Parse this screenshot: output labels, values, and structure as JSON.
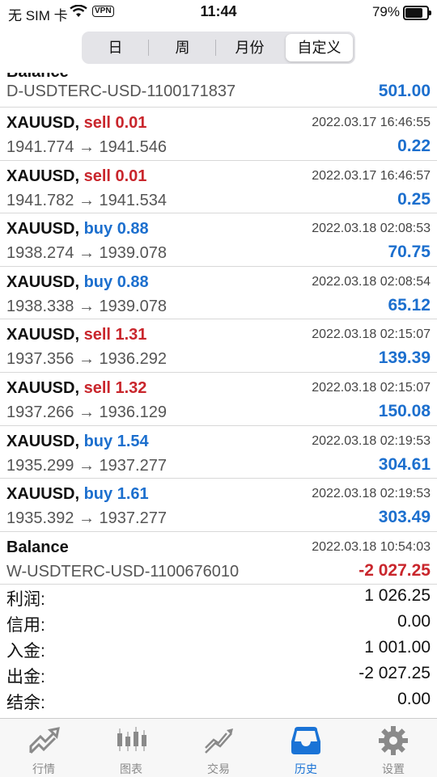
{
  "status": {
    "carrier": "无 SIM 卡",
    "vpn": "VPN",
    "time": "11:44",
    "battery": "79%"
  },
  "tabs": [
    "日",
    "周",
    "月份",
    "自定义"
  ],
  "first_row": {
    "title": "Balance",
    "subtitle": "D-USDTERC-USD-1100171837",
    "amount": "501.00"
  },
  "rows": [
    {
      "symbol": "XAUUSD,",
      "side": "sell 0.01",
      "type": "sell",
      "date": "2022.03.17 16:46:55",
      "prices": "1941.774 → 1941.546",
      "profit": "0.22",
      "neg": false
    },
    {
      "symbol": "XAUUSD,",
      "side": "sell 0.01",
      "type": "sell",
      "date": "2022.03.17 16:46:57",
      "prices": "1941.782 → 1941.534",
      "profit": "0.25",
      "neg": false
    },
    {
      "symbol": "XAUUSD,",
      "side": "buy 0.88",
      "type": "buy",
      "date": "2022.03.18 02:08:53",
      "prices": "1938.274 → 1939.078",
      "profit": "70.75",
      "neg": false
    },
    {
      "symbol": "XAUUSD,",
      "side": "buy 0.88",
      "type": "buy",
      "date": "2022.03.18 02:08:54",
      "prices": "1938.338 → 1939.078",
      "profit": "65.12",
      "neg": false
    },
    {
      "symbol": "XAUUSD,",
      "side": "sell 1.31",
      "type": "sell",
      "date": "2022.03.18 02:15:07",
      "prices": "1937.356 → 1936.292",
      "profit": "139.39",
      "neg": false
    },
    {
      "symbol": "XAUUSD,",
      "side": "sell 1.32",
      "type": "sell",
      "date": "2022.03.18 02:15:07",
      "prices": "1937.266 → 1936.129",
      "profit": "150.08",
      "neg": false
    },
    {
      "symbol": "XAUUSD,",
      "side": "buy 1.54",
      "type": "buy",
      "date": "2022.03.18 02:19:53",
      "prices": "1935.299 → 1937.277",
      "profit": "304.61",
      "neg": false
    },
    {
      "symbol": "XAUUSD,",
      "side": "buy 1.61",
      "type": "buy",
      "date": "2022.03.18 02:19:53",
      "prices": "1935.392 → 1937.277",
      "profit": "303.49",
      "neg": false
    },
    {
      "symbol": "Balance",
      "side": "",
      "type": "",
      "date": "2022.03.18 10:54:03",
      "prices": "W-USDTERC-USD-1100676010",
      "profit": "-2 027.25",
      "neg": true
    }
  ],
  "summary": [
    {
      "label": "利润:",
      "value": "1 026.25"
    },
    {
      "label": "信用:",
      "value": "0.00"
    },
    {
      "label": "入金:",
      "value": "1 001.00"
    },
    {
      "label": "出金:",
      "value": "-2 027.25"
    },
    {
      "label": "结余:",
      "value": "0.00"
    }
  ],
  "tabbar": [
    {
      "label": "行情",
      "icon": "quotes-icon"
    },
    {
      "label": "图表",
      "icon": "chart-icon"
    },
    {
      "label": "交易",
      "icon": "trade-icon"
    },
    {
      "label": "历史",
      "icon": "history-icon",
      "active": true
    },
    {
      "label": "设置",
      "icon": "settings-icon"
    }
  ]
}
